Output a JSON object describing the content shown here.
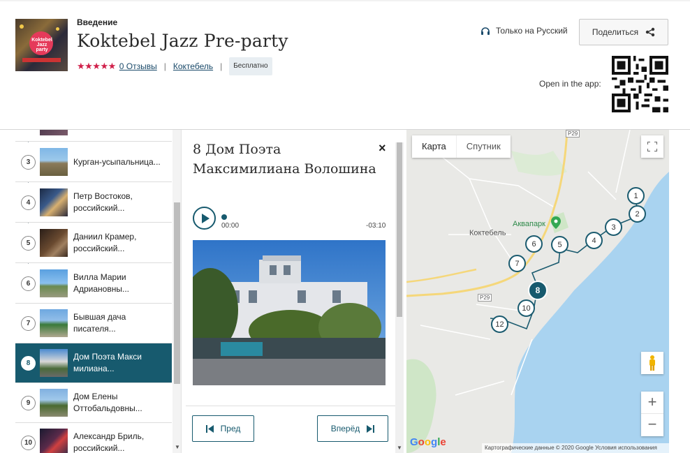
{
  "header": {
    "section_label": "Введение",
    "title": "Koktebel Jazz Pre-party",
    "rating_stars": "★★★★★",
    "reviews_link": "0 Отзывы",
    "location_link": "Коктебель",
    "price_badge": "Бесплатно",
    "language": "Только на Русский",
    "share_label": "Поделиться",
    "open_app_label": "Open in the app:",
    "cover_text": "Koktebel Jazz party"
  },
  "sidebar": {
    "items": [
      {
        "num": "",
        "label": ""
      },
      {
        "num": "3",
        "label": "Курган-усыпальница..."
      },
      {
        "num": "4",
        "label": "Петр Востоков, российский..."
      },
      {
        "num": "5",
        "label": "Даниил Крамер, российский..."
      },
      {
        "num": "6",
        "label": "Вилла Марии Адриановны..."
      },
      {
        "num": "7",
        "label": "Бывшая дача писателя..."
      },
      {
        "num": "8",
        "label": "Дом Поэта Макси милиана..."
      },
      {
        "num": "9",
        "label": "Дом Елены Оттобальдовны..."
      },
      {
        "num": "10",
        "label": "Александр Бриль, российский..."
      }
    ]
  },
  "detail": {
    "title": "8 Дом Поэта Максимилиана Волошина",
    "close": "×",
    "time_start": "00:00",
    "time_end": "-03:10",
    "prev_label": "Пред",
    "next_label": "Вперёд"
  },
  "map": {
    "tab_map": "Карта",
    "tab_satellite": "Спутник",
    "label_town": "Коктебель",
    "label_aquapark": "Аквапарк",
    "road_label_1": "P29",
    "road_label_2": "P29",
    "google": "Google",
    "attribution": "Картографические данные © 2020 Google   Условия использования",
    "zoom_in": "+",
    "zoom_out": "−",
    "markers": [
      "1",
      "2",
      "3",
      "4",
      "5",
      "6",
      "7",
      "8",
      "10",
      "12"
    ],
    "active_marker": "8"
  },
  "colors": {
    "accent": "#175a6e",
    "stars": "#d0204a",
    "water": "#a9d3f0",
    "land": "#e9e9e6"
  }
}
